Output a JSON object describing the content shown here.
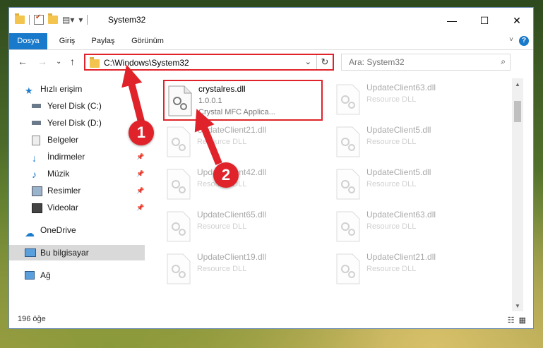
{
  "window": {
    "title": "System32",
    "controls": {
      "minimize": "—",
      "maximize": "☐",
      "close": "✕"
    }
  },
  "ribbon": {
    "tabs": [
      {
        "label": "Dosya",
        "active": true
      },
      {
        "label": "Giriş",
        "active": false
      },
      {
        "label": "Paylaş",
        "active": false
      },
      {
        "label": "Görünüm",
        "active": false
      }
    ],
    "help": "?"
  },
  "nav": {
    "address": "C:\\Windows\\System32",
    "search_placeholder": "Ara: System32"
  },
  "sidebar": {
    "items": [
      {
        "label": "Hızlı erişim",
        "icon": "star-icon"
      },
      {
        "label": "Yerel Disk (C:)",
        "icon": "drive-icon"
      },
      {
        "label": "Yerel Disk (D:)",
        "icon": "drive-icon"
      },
      {
        "label": "Belgeler",
        "icon": "documents-icon"
      },
      {
        "label": "İndirmeler",
        "icon": "download-icon"
      },
      {
        "label": "Müzik",
        "icon": "music-icon"
      },
      {
        "label": "Resimler",
        "icon": "pictures-icon"
      },
      {
        "label": "Videolar",
        "icon": "video-icon"
      },
      {
        "label": "OneDrive",
        "icon": "cloud-icon"
      },
      {
        "label": "Bu bilgisayar",
        "icon": "computer-icon"
      },
      {
        "label": "Ağ",
        "icon": "network-icon"
      }
    ]
  },
  "files": [
    {
      "name": "crystalres.dll",
      "line2": "1.0.0.1",
      "line3": "Crystal MFC Applica..."
    },
    {
      "name": "UpdateClient63.dll",
      "line2": "Resource DLL",
      "line3": ""
    },
    {
      "name": "UpdateClient21.dll",
      "line2": "Resource DLL",
      "line3": ""
    },
    {
      "name": "UpdateClient5.dll",
      "line2": "Resource DLL",
      "line3": ""
    },
    {
      "name": "UpdateClient42.dll",
      "line2": "Resource DLL",
      "line3": ""
    },
    {
      "name": "UpdateClient5.dll",
      "line2": "Resource DLL",
      "line3": ""
    },
    {
      "name": "UpdateClient65.dll",
      "line2": "Resource DLL",
      "line3": ""
    },
    {
      "name": "UpdateClient63.dll",
      "line2": "Resource DLL",
      "line3": ""
    },
    {
      "name": "UpdateClient19.dll",
      "line2": "Resource DLL",
      "line3": ""
    },
    {
      "name": "UpdateClient21.dll",
      "line2": "Resource DLL",
      "line3": ""
    }
  ],
  "status": {
    "count": "196 öğe"
  },
  "markers": {
    "one": "1",
    "two": "2"
  },
  "colors": {
    "accent": "#1979ca",
    "highlight": "#e0232a"
  }
}
